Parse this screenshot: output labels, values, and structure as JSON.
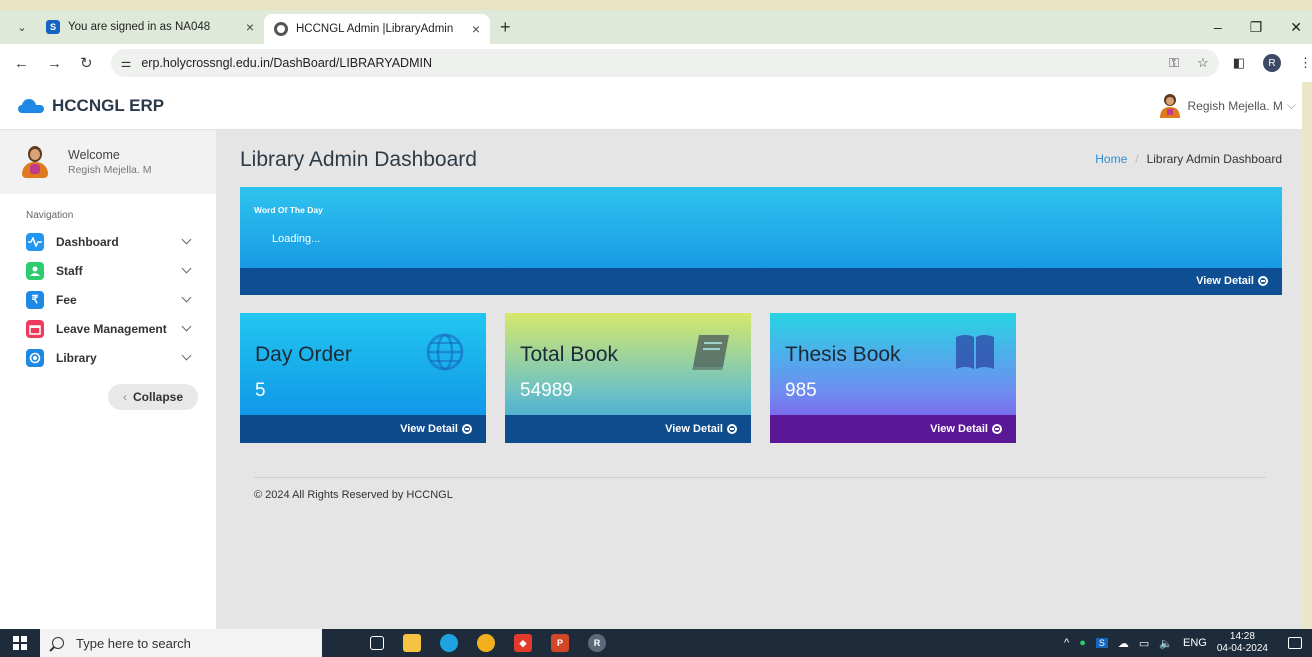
{
  "browser": {
    "tabs": [
      {
        "title": "You are signed in as NA048",
        "favicon": "S",
        "active": false
      },
      {
        "title": "HCCNGL Admin |LibraryAdmin",
        "favicon": "globe",
        "active": true
      }
    ],
    "new_tab": "+",
    "url": "erp.holycrossngl.edu.in/DashBoard/LIBRARYADMIN",
    "profile_initial": "R"
  },
  "app": {
    "brand": "HCCNGL ERP",
    "user_name": "Regish Mejella. M"
  },
  "sidebar": {
    "welcome": "Welcome",
    "user": "Regish Mejella. M",
    "nav_label": "Navigation",
    "items": [
      {
        "label": "Dashboard",
        "icon": "pulse-icon",
        "color": "#2196f3"
      },
      {
        "label": "Staff",
        "icon": "staff-icon",
        "color": "#2ecc71"
      },
      {
        "label": "Fee",
        "icon": "rupee-icon",
        "color": "#1e88e5"
      },
      {
        "label": "Leave Management",
        "icon": "calendar-icon",
        "color": "#ef3b5b"
      },
      {
        "label": "Library",
        "icon": "library-icon",
        "color": "#1e88e5"
      }
    ],
    "collapse": "Collapse"
  },
  "main": {
    "title": "Library Admin Dashboard",
    "breadcrumb": {
      "home": "Home",
      "current": "Library Admin Dashboard"
    },
    "word_of_day": {
      "label": "Word Of The Day",
      "text": "Loading...",
      "link": "View Detail"
    },
    "cards": [
      {
        "title": "Day Order",
        "value": "5",
        "link": "View Detail",
        "icon": "globe-icon"
      },
      {
        "title": "Total Book",
        "value": "54989",
        "link": "View Detail",
        "icon": "book-icon"
      },
      {
        "title": "Thesis Book",
        "value": "985",
        "link": "View Detail",
        "icon": "open-book-icon"
      }
    ],
    "footer": "© 2024 All Rights Reserved by HCCNGL"
  },
  "taskbar": {
    "search_placeholder": "Type here to search",
    "language": "ENG",
    "time": "14:28",
    "date": "04-04-2024"
  }
}
